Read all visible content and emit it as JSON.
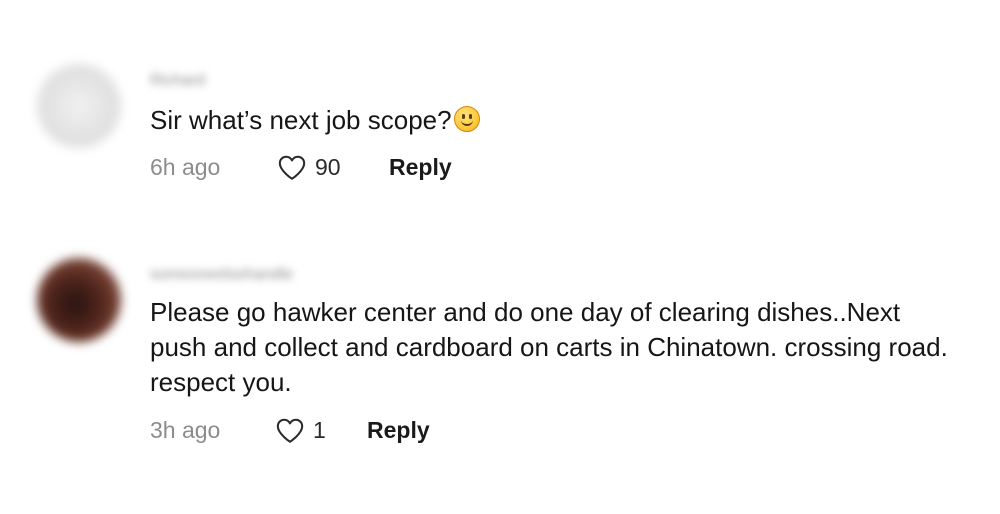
{
  "comments": [
    {
      "username": "Richard",
      "text": "Sir what’s next job scope?",
      "emoji": "slightly-smiling-face",
      "time": "6h ago",
      "likes": "90",
      "reply_label": "Reply"
    },
    {
      "username": "someoneelsehandle",
      "text": "Please go hawker center and do one day of clearing dishes..Next push and collect and cardboard on carts in Chinatown. crossing road. respect you.",
      "time": "3h ago",
      "likes": "1",
      "reply_label": "Reply"
    }
  ],
  "colors": {
    "text": "#161616",
    "meta": "#8c8c8c",
    "emoji": "#fcc93b"
  }
}
